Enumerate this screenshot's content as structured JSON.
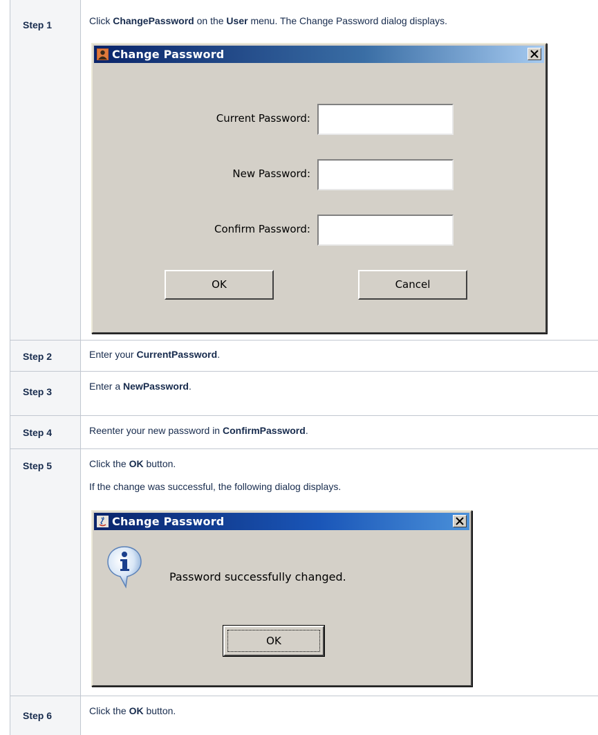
{
  "steps": [
    {
      "label": "Step 1",
      "text_parts": [
        "Click ",
        "ChangePassword",
        " on the ",
        "User",
        " menu. The Change Password dialog displays."
      ]
    },
    {
      "label": "Step 2",
      "text_parts": [
        "Enter your ",
        "CurrentPassword",
        "."
      ]
    },
    {
      "label": "Step 3",
      "text_parts": [
        "Enter a ",
        "NewPassword",
        "."
      ]
    },
    {
      "label": "Step 4",
      "text_parts": [
        "Reenter your new password in ",
        "ConfirmPassword",
        "."
      ]
    },
    {
      "label": "Step 5",
      "text_parts": [
        "Click the ",
        "OK",
        " button."
      ],
      "text2": "If the change was successful, the following dialog displays."
    },
    {
      "label": "Step 6",
      "text_parts": [
        "Click the ",
        "OK",
        " button."
      ]
    }
  ],
  "dialog1": {
    "title": "Change Password",
    "current_label": "Current Password:",
    "new_label": "New Password:",
    "confirm_label": "Confirm Password:",
    "current_value": "",
    "new_value": "",
    "confirm_value": "",
    "ok_label": "OK",
    "cancel_label": "Cancel"
  },
  "dialog2": {
    "title": "Change Password",
    "message": "Password successfully changed.",
    "ok_label": "OK"
  },
  "colors": {
    "titlebar": "#0a246a",
    "dialog_face": "#d4d0c8",
    "header_bg": "#f4f5f7",
    "border": "#c1c7d0"
  },
  "icons": {
    "dialog1_title_icon": "user-icon",
    "dialog2_title_icon": "java-icon",
    "close_icon": "close-icon",
    "info_icon": "info-icon"
  }
}
